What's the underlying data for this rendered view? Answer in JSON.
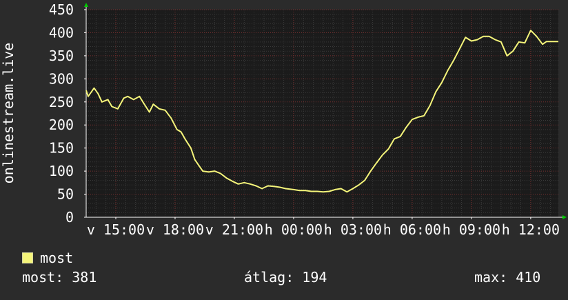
{
  "colors": {
    "background": "#2b2b2b",
    "plot_background": "#1b1b1b",
    "grid_minor": "#3a3a3a",
    "grid_major": "#7a2f2f",
    "line": "#f5f57a",
    "arrow": "#00cc00"
  },
  "chart_data": {
    "type": "line",
    "ylabel": "onlinestream.live",
    "ylim": [
      0,
      450
    ],
    "yticks": [
      0,
      50,
      100,
      150,
      200,
      250,
      300,
      350,
      400,
      450
    ],
    "ytick_labels": [
      "0",
      "50",
      "100",
      "150",
      "200",
      "250",
      "300",
      "350",
      "400",
      "450"
    ],
    "x_range_hours": [
      13.5,
      37.4
    ],
    "xticks": [
      {
        "hour": 15,
        "label": "v 15:00"
      },
      {
        "hour": 18,
        "label": "v 18:00"
      },
      {
        "hour": 21,
        "label": "v 21:00"
      },
      {
        "hour": 24,
        "label": "h 00:00"
      },
      {
        "hour": 27,
        "label": "h 03:00"
      },
      {
        "hour": 30,
        "label": "h 06:00"
      },
      {
        "hour": 33,
        "label": "h 09:00"
      },
      {
        "hour": 36,
        "label": "h 12:00"
      }
    ],
    "grid": true,
    "legend_position": "bottom-left",
    "series": [
      {
        "name": "most",
        "x": [
          13.5,
          13.6,
          13.9,
          14.1,
          14.3,
          14.6,
          14.8,
          15.1,
          15.4,
          15.6,
          15.9,
          16.2,
          16.4,
          16.7,
          16.9,
          17.2,
          17.5,
          17.8,
          18.1,
          18.3,
          18.5,
          18.8,
          19.0,
          19.4,
          19.7,
          20.0,
          20.3,
          20.6,
          20.9,
          21.2,
          21.5,
          21.8,
          22.1,
          22.4,
          22.7,
          23.0,
          23.3,
          23.6,
          24.0,
          24.3,
          24.6,
          24.9,
          25.2,
          25.5,
          25.8,
          26.1,
          26.4,
          26.7,
          27.0,
          27.3,
          27.6,
          27.9,
          28.2,
          28.5,
          28.8,
          29.1,
          29.4,
          29.7,
          30.0,
          30.3,
          30.6,
          30.9,
          31.2,
          31.5,
          31.8,
          32.1,
          32.4,
          32.7,
          33.0,
          33.3,
          33.6,
          33.9,
          34.2,
          34.5,
          34.8,
          35.1,
          35.4,
          35.7,
          36.0,
          36.3,
          36.6,
          36.8,
          37.0,
          37.2,
          37.4
        ],
        "y": [
          275,
          262,
          280,
          268,
          250,
          255,
          240,
          235,
          258,
          262,
          255,
          262,
          248,
          228,
          245,
          235,
          232,
          215,
          190,
          185,
          170,
          150,
          125,
          100,
          98,
          100,
          95,
          85,
          78,
          72,
          75,
          72,
          68,
          62,
          68,
          67,
          65,
          62,
          60,
          58,
          58,
          56,
          56,
          55,
          56,
          60,
          62,
          55,
          62,
          70,
          80,
          100,
          118,
          135,
          148,
          170,
          175,
          195,
          212,
          217,
          220,
          242,
          272,
          292,
          318,
          340,
          365,
          390,
          382,
          385,
          392,
          392,
          385,
          380,
          350,
          360,
          380,
          378,
          405,
          392,
          375,
          381,
          381,
          381,
          381
        ]
      }
    ]
  },
  "legend": {
    "series_label": "most"
  },
  "stats": {
    "current": "most: 381",
    "average": "átlag: 194",
    "max": "max: 410"
  }
}
